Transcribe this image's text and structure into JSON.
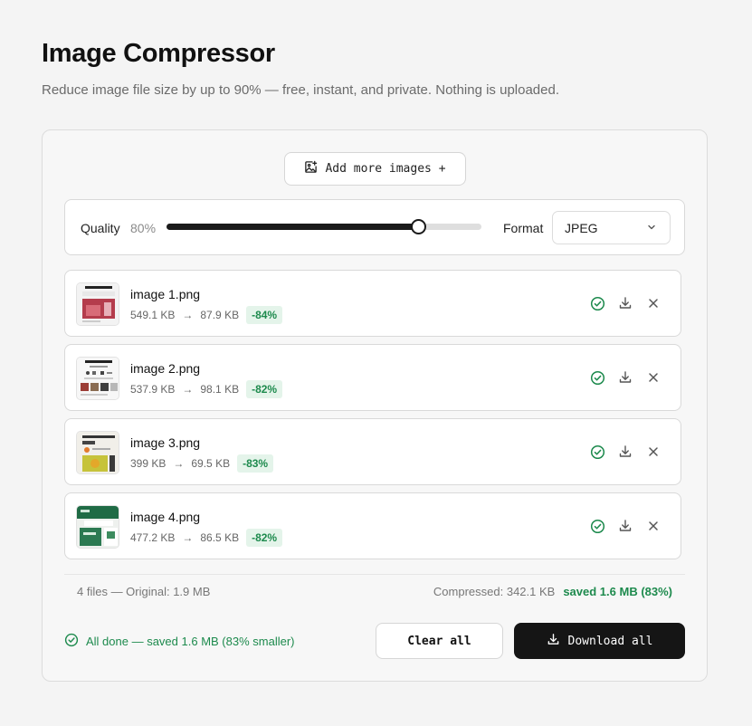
{
  "header": {
    "title": "Image Compressor",
    "subtitle": "Reduce image file size by up to 90% — free, instant, and private. Nothing is uploaded."
  },
  "add_button": {
    "label": "Add more images +"
  },
  "settings": {
    "quality_label": "Quality",
    "quality_value": "80%",
    "quality_fraction": 0.8,
    "format_label": "Format",
    "format_value": "JPEG"
  },
  "files": [
    {
      "name": "image 1.png",
      "original": "549.1 KB",
      "arrow": "→",
      "compressed": "87.9 KB",
      "reduction": "-84%"
    },
    {
      "name": "image 2.png",
      "original": "537.9 KB",
      "arrow": "→",
      "compressed": "98.1 KB",
      "reduction": "-82%"
    },
    {
      "name": "image 3.png",
      "original": "399 KB",
      "arrow": "→",
      "compressed": "69.5 KB",
      "reduction": "-83%"
    },
    {
      "name": "image 4.png",
      "original": "477.2 KB",
      "arrow": "→",
      "compressed": "86.5 KB",
      "reduction": "-82%"
    }
  ],
  "summary": {
    "left": "4 files — Original: 1.9 MB",
    "compressed": "Compressed: 342.1 KB",
    "saved": "saved 1.6 MB (83%)"
  },
  "status": {
    "text": "All done — saved 1.6 MB (83% smaller)"
  },
  "footer_buttons": {
    "clear_all": "Clear all",
    "download_all": "Download all"
  },
  "colors": {
    "accent_green": "#1d8a4d",
    "badge_bg": "#e4f4ea",
    "primary_dark": "#151515"
  },
  "icons": {
    "add_image": "image-plus-icon",
    "status": "check-circle-icon",
    "download": "download-icon",
    "remove": "close-icon",
    "dropdown": "chevron-down-icon"
  }
}
